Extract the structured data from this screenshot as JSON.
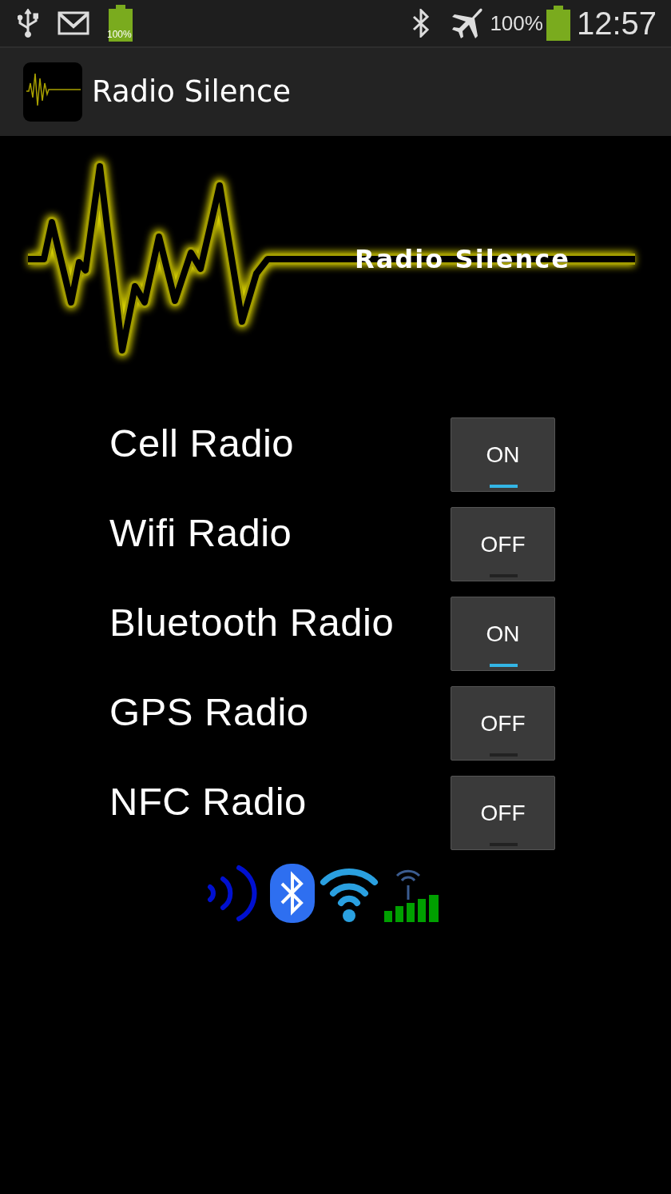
{
  "status_bar": {
    "left_battery_label": "100%",
    "battery_percent": "100%",
    "time": "12:57"
  },
  "action_bar": {
    "title": "Radio Silence"
  },
  "banner": {
    "text": "Radio Silence"
  },
  "radios": [
    {
      "label": "Cell Radio",
      "toggle": "ON",
      "on": true
    },
    {
      "label": "Wifi Radio",
      "toggle": "OFF",
      "on": false
    },
    {
      "label": "Bluetooth Radio",
      "toggle": "ON",
      "on": true
    },
    {
      "label": "GPS Radio",
      "toggle": "OFF",
      "on": false
    },
    {
      "label": "NFC Radio",
      "toggle": "OFF",
      "on": false
    }
  ]
}
